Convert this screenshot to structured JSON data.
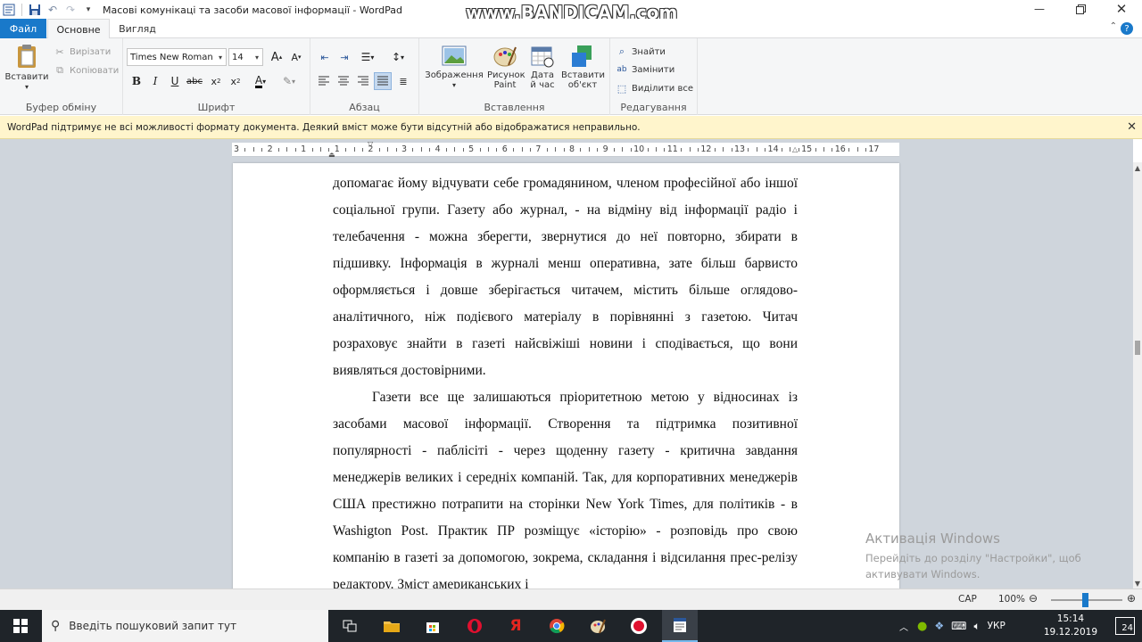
{
  "window": {
    "title": "Масові комунікаці та засоби масової інформації - WordPad",
    "watermark": "www.BANDICAM.com"
  },
  "tabs": [
    {
      "label": "Файл"
    },
    {
      "label": "Основне"
    },
    {
      "label": "Вигляд"
    }
  ],
  "ribbon": {
    "clipboard": {
      "group_label": "Буфер обміну",
      "paste": "Вставити",
      "cut": "Вирізати",
      "copy": "Копіювати"
    },
    "font": {
      "group_label": "Шрифт",
      "font_name": "Times New Roman",
      "font_size": "14"
    },
    "paragraph": {
      "group_label": "Абзац"
    },
    "insert": {
      "group_label": "Вставлення",
      "picture": "Зображення",
      "paint": "Рисунок Paint",
      "datetime": "Дата й час",
      "object": "Вставити об'єкт"
    },
    "editing": {
      "group_label": "Редагування",
      "find": "Знайти",
      "replace": "Замінити",
      "select_all": "Виділити все"
    }
  },
  "infobar": {
    "message": "WordPad підтримує не всі можливості формату документа. Деякий вміст може бути відсутній або відображатися неправильно."
  },
  "ruler": {
    "labels": [
      "3",
      "2",
      "1",
      "1",
      "2",
      "3",
      "4",
      "5",
      "6",
      "7",
      "8",
      "9",
      "10",
      "11",
      "12",
      "13",
      "14",
      "15",
      "16",
      "17"
    ]
  },
  "document": {
    "paragraph1": "допомагає йому відчувати себе громадянином, членом професійної або іншої соціальної групи. Газету або журнал, - на відміну від інформації радіо і телебачення - можна зберегти, звернутися до неї повторно, збирати в підшивку. Інформація в журналі менш оперативна, зате більш барвисто оформляється і довше зберігається читачем, містить більше оглядово-аналітичного, ніж подієвого матеріалу в порівнянні з газетою. Читач розраховує знайти в газеті найсвіжіші новини і сподівається, що вони виявляться достовірними.",
    "paragraph2": "Газети все ще залишаються пріоритетною метою у відносинах із засобами масової інформації. Створення та підтримка позитивної популярності - паблісіті - через щоденну газету - критична завдання менеджерів великих і середніх компаній. Так, для корпоративних менеджерів США престижно потрапити на сторінки New York Times, для політиків - в Washigton Post. Практик ПР розміщує «історію» - розповідь про свою компанію в газеті за допомогою, зокрема, складання і відсилання прес-релізу редактору. Зміст американських і"
  },
  "activation": {
    "title": "Активація Windows",
    "line1": "Перейдіть до розділу \"Настройки\", щоб",
    "line2": "активувати Windows."
  },
  "statusbar": {
    "caps": "CAP",
    "zoom": "100%",
    "zoom_level_percent": 100
  },
  "taskbar": {
    "search_placeholder": "Введіть пошуковий запит тут",
    "language": "УКР",
    "time": "15:14",
    "date": "19.12.2019",
    "notifications": "24"
  },
  "colors": {
    "accent": "#1979ca",
    "infobar": "#fff5cc",
    "taskbar": "#1f2429"
  }
}
